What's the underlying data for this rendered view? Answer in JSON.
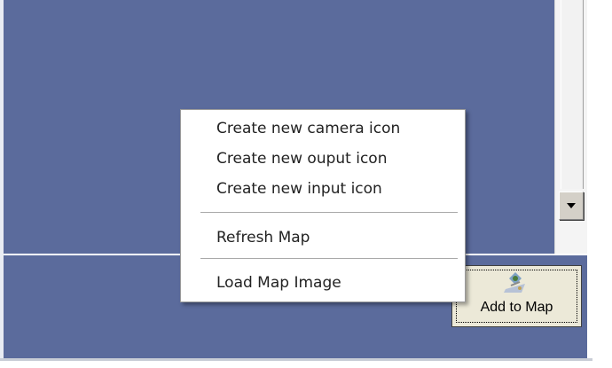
{
  "context_menu": {
    "items": [
      {
        "label": "Create new camera icon"
      },
      {
        "label": "Create new ouput icon"
      },
      {
        "label": "Create new input icon"
      },
      {
        "label": "Refresh Map"
      },
      {
        "label": "Load Map Image"
      }
    ]
  },
  "toolbar": {
    "add_to_map_label": "Add to Map",
    "add_to_map_icon": "map-pin-icon"
  },
  "scrollbar": {
    "down_icon": "arrow-down-icon"
  },
  "colors": {
    "map_background": "#5b6b9c",
    "menu_background": "#ffffff",
    "button_face": "#ece9d8"
  }
}
